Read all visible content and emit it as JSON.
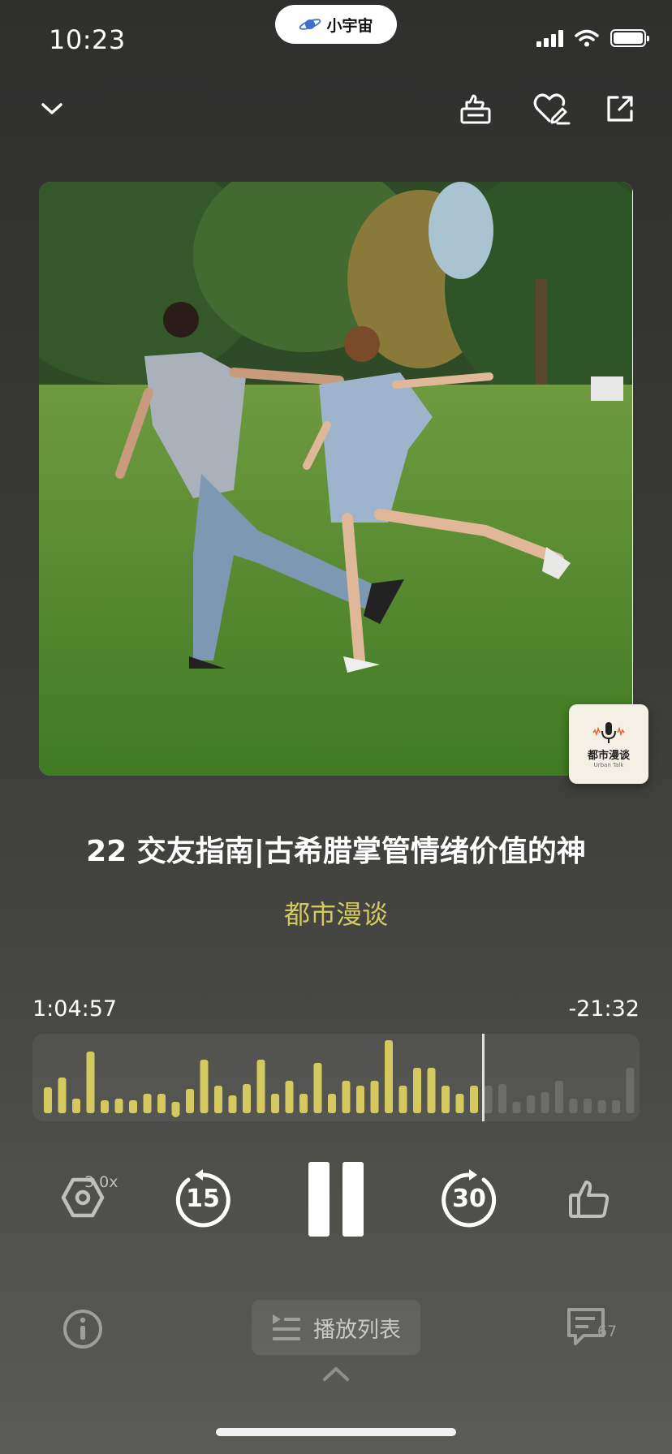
{
  "status_bar": {
    "time": "10:23",
    "island_app": "小宇宙"
  },
  "top_nav": {
    "collapse_icon": "chevron-down-icon",
    "actions": [
      "thumbs-up-card-icon",
      "heart-edit-icon",
      "share-icon"
    ]
  },
  "cover": {
    "badge_title": "都市漫谈",
    "badge_subtitle": "Urban Talk"
  },
  "episode": {
    "title": "22 交友指南|古希腊掌管情绪价值的神",
    "podcast": "都市漫谈"
  },
  "progress": {
    "elapsed": "1:04:57",
    "remaining": "-21:32",
    "played_fraction": 0.75
  },
  "controls": {
    "speed": "3.0x",
    "rewind_seconds": "15",
    "forward_seconds": "30",
    "state": "playing"
  },
  "bottom": {
    "playlist_label": "播放列表",
    "comment_count": "67"
  },
  "colors": {
    "accent": "#d3c95f",
    "background": "#3a3a38"
  }
}
